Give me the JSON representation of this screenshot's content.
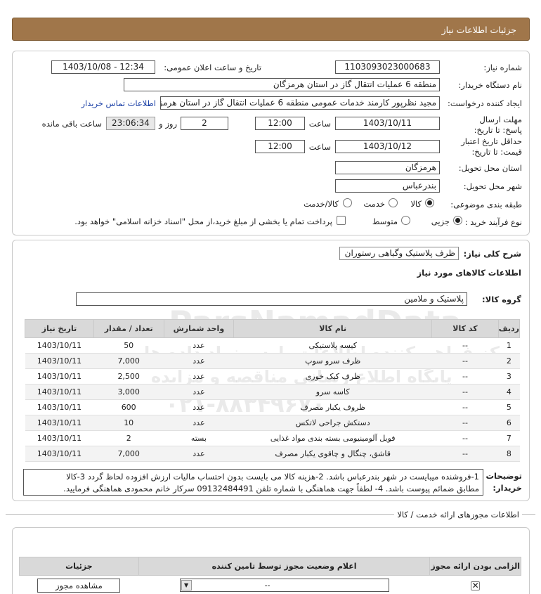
{
  "header": {
    "title": "جزئیات اطلاعات نیاز"
  },
  "form": {
    "need_number_label": "شماره نیاز:",
    "need_number": "1103093023000683",
    "announce_label": "تاریخ و ساعت اعلان عمومی:",
    "announce_value": "1403/10/08 - 12:34",
    "buyer_label": "نام دستگاه خریدار:",
    "buyer_value": "منطقه 6 عملیات انتقال گاز در استان هرمزگان",
    "creator_label": "ایجاد کننده درخواست:",
    "creator_value": "مجید نظرپور کارمند خدمات عمومی منطقه 6 عملیات انتقال گاز در استان هرمزگان",
    "contact_link": "اطلاعات تماس خریدار",
    "reply_deadline_label": "مهلت ارسال پاسخ: تا تاریخ:",
    "reply_date": "1403/10/11",
    "time_label": "ساعت",
    "reply_time": "12:00",
    "days_value": "2",
    "days_label": "روز و",
    "remaining_value": "23:06:34",
    "remaining_label": "ساعت باقی مانده",
    "validity_label": "حداقل تاریخ اعتبار قیمت: تا تاریخ:",
    "validity_date": "1403/10/12",
    "validity_time": "12:00",
    "province_label": "استان محل تحویل:",
    "province_value": "هرمزگان",
    "city_label": "شهر محل تحویل:",
    "city_value": "بندرعباس",
    "category_label": "طبقه بندی موضوعی:",
    "category_options": [
      "کالا",
      "خدمت",
      "کالا/خدمت"
    ],
    "category_selected": "کالا",
    "purchase_label": "نوع فرآیند خرید :",
    "purchase_options": [
      "جزیی",
      "متوسط"
    ],
    "purchase_selected": "جزیی",
    "treasury_note": "پرداخت تمام یا بخشی از مبلغ خرید،از محل \"اسناد خزانه اسلامی\" خواهد بود."
  },
  "summary": {
    "label": "شرح کلی نیاز:",
    "value": "ظرف پلاستیک وگیاهی رستوران",
    "goods_info_title": "اطلاعات کالاهای مورد نیاز",
    "group_label": "گروه کالا:",
    "group_value": "پلاستیک و ملامین"
  },
  "table": {
    "headers": [
      "ردیف",
      "کد کالا",
      "نام کالا",
      "واحد شمارش",
      "تعداد / مقدار",
      "تاریخ نیاز"
    ],
    "rows": [
      [
        "1",
        "--",
        "کیسه پلاستیکی",
        "عدد",
        "50",
        "1403/10/11"
      ],
      [
        "2",
        "--",
        "ظرف سرو سوپ",
        "عدد",
        "7,000",
        "1403/10/11"
      ],
      [
        "3",
        "--",
        "ظرف کیک خوری",
        "عدد",
        "2,500",
        "1403/10/11"
      ],
      [
        "4",
        "--",
        "کاسه سرو",
        "عدد",
        "3,000",
        "1403/10/11"
      ],
      [
        "5",
        "--",
        "ظروف یکبار مصرف",
        "عدد",
        "600",
        "1403/10/11"
      ],
      [
        "6",
        "--",
        "دستکش جراحی لاتکس",
        "عدد",
        "10",
        "1403/10/11"
      ],
      [
        "7",
        "--",
        "فویل آلومینیومی بسته بندی مواد غذایی",
        "بسته",
        "2",
        "1403/10/11"
      ],
      [
        "8",
        "--",
        "قاشق، چنگال و چاقوی یکبار مصرف",
        "عدد",
        "7,000",
        "1403/10/11"
      ]
    ]
  },
  "buyer_notes": {
    "label_line1": "توضیحات",
    "label_line2": "خریدار:",
    "line1": "1-فروشنده میبایست در شهر بندرعباس باشد. 2-هزینه کالا می بایست بدون احتساب مالیات ارزش افزوده لحاظ گردد 3-کالا",
    "line2": "مطابق ضمائم پیوست باشد. 4- لطفاً جهت هماهنگی با شماره تلفن 09132484491 سرکار خانم محمودی هماهنگی فرمایید."
  },
  "permits": {
    "title": "اطلاعات مجوزهای ارائه خدمت / کالا",
    "headers": [
      "الزامی بودن ارائه مجوز",
      "اعلام وضعیت مجوز توسط تامین کننده",
      "جزئیات"
    ],
    "status_value": "--",
    "view_button": "مشاهده مجوز"
  },
  "watermark": {
    "brand": "ParsNamadData",
    "line1": "مرکز فراهم کننده اطلاعات پارس نماد داده ها",
    "line2": "پایگاه اطلاع رسانی مناقصه و مزایده",
    "phone": "۰۲۱-۸۸۳۴۹۶۷۰"
  }
}
